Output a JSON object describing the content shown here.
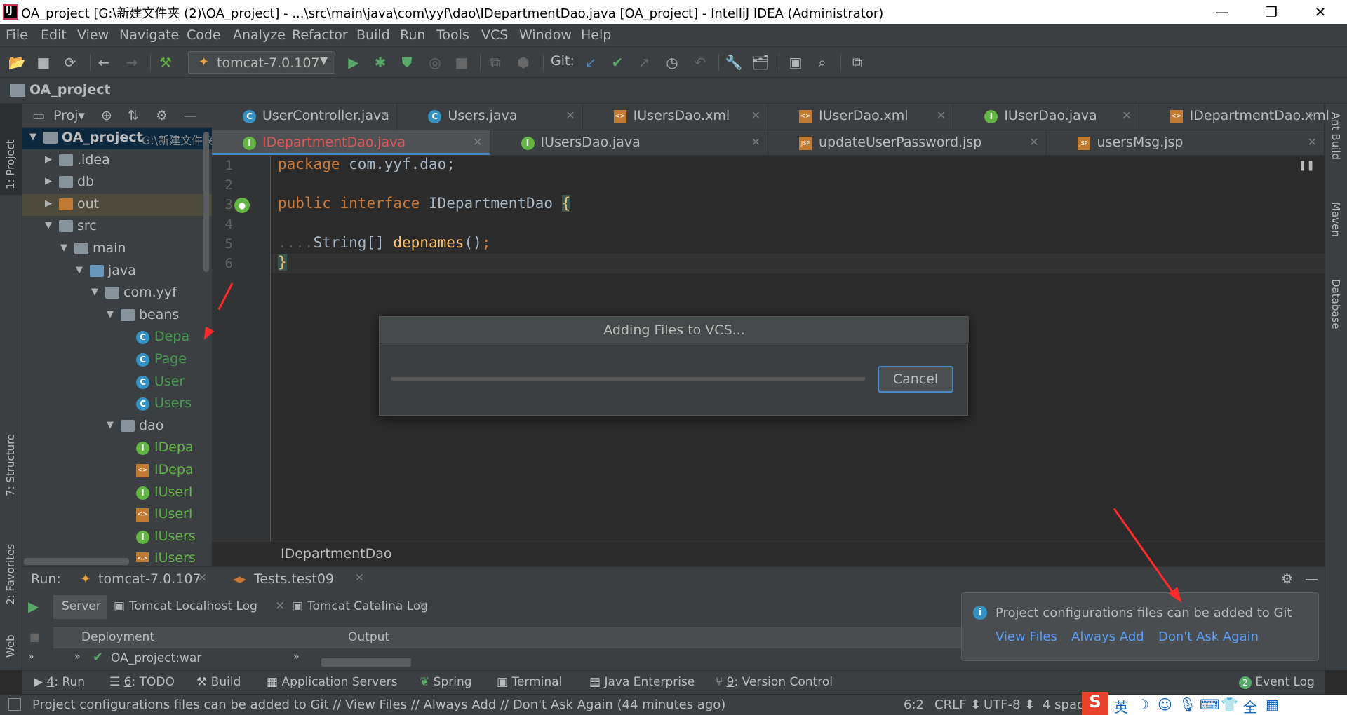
{
  "window": {
    "title": "OA_project [G:\\新建文件夹 (2)\\OA_project] - ...\\src\\main\\java\\com\\yyf\\dao\\IDepartmentDao.java [OA_project] - IntelliJ IDEA (Administrator)",
    "app_icon_letter": "IJ",
    "minimize": "—",
    "maximize": "❐",
    "close": "✕"
  },
  "menu": [
    "File",
    "Edit",
    "View",
    "Navigate",
    "Code",
    "Analyze",
    "Refactor",
    "Build",
    "Run",
    "Tools",
    "VCS",
    "Window",
    "Help"
  ],
  "toolbar": {
    "run_config": "tomcat-7.0.107",
    "git_label": "Git:"
  },
  "navbar": {
    "project": "OA_project"
  },
  "left_strip": {
    "project_tab": "1: Project",
    "structure_tab": "7: Structure",
    "favorites_tab": "2: Favorites",
    "web_tab": "Web"
  },
  "right_strip": {
    "ant_tab": "Ant Build",
    "maven_tab": "Maven",
    "database_tab": "Database"
  },
  "project_panel": {
    "header": "Proj▾",
    "tree": [
      {
        "label": "OA_project",
        "suffix": "G:\\新建文件夹",
        "icon": "project-folder",
        "level": 0,
        "expanded": true,
        "bold": true
      },
      {
        "label": ".idea",
        "icon": "folder",
        "level": 1,
        "expanded": false
      },
      {
        "label": "db",
        "icon": "folder",
        "level": 1,
        "expanded": false
      },
      {
        "label": "out",
        "icon": "folder-excluded",
        "level": 1,
        "expanded": false
      },
      {
        "label": "src",
        "icon": "folder",
        "level": 1,
        "expanded": true
      },
      {
        "label": "main",
        "icon": "folder",
        "level": 2,
        "expanded": true
      },
      {
        "label": "java",
        "icon": "source-folder",
        "level": 3,
        "expanded": true
      },
      {
        "label": "com.yyf",
        "icon": "package",
        "level": 4,
        "expanded": true
      },
      {
        "label": "beans",
        "icon": "package",
        "level": 5,
        "expanded": true
      },
      {
        "label": "Depa",
        "icon": "class",
        "level": 6
      },
      {
        "label": "Page",
        "icon": "class",
        "level": 6
      },
      {
        "label": "User",
        "icon": "class",
        "level": 6
      },
      {
        "label": "Users",
        "icon": "class",
        "level": 6
      },
      {
        "label": "dao",
        "icon": "package",
        "level": 5,
        "expanded": true
      },
      {
        "label": "IDepa",
        "icon": "interface",
        "level": 6
      },
      {
        "label": "IDepa",
        "icon": "xml",
        "level": 6
      },
      {
        "label": "IUserI",
        "icon": "interface",
        "level": 6
      },
      {
        "label": "IUserI",
        "icon": "xml",
        "level": 6
      },
      {
        "label": "IUsers",
        "icon": "interface",
        "level": 6
      },
      {
        "label": "IUsers",
        "icon": "xml",
        "level": 6
      }
    ]
  },
  "editor_tabs_row1": [
    {
      "label": "UserController.java",
      "icon": "class"
    },
    {
      "label": "Users.java",
      "icon": "class"
    },
    {
      "label": "IUsersDao.xml",
      "icon": "xml"
    },
    {
      "label": "IUserDao.xml",
      "icon": "xml"
    },
    {
      "label": "IUserDao.java",
      "icon": "interface"
    },
    {
      "label": "IDepartmentDao.xml",
      "icon": "xml"
    }
  ],
  "editor_tabs_row2": [
    {
      "label": "IDepartmentDao.java",
      "icon": "interface",
      "active": true
    },
    {
      "label": "IUsersDao.java",
      "icon": "interface"
    },
    {
      "label": "updateUserPassword.jsp",
      "icon": "jsp"
    },
    {
      "label": "usersMsg.jsp",
      "icon": "jsp"
    }
  ],
  "editor": {
    "line_numbers": [
      "1",
      "2",
      "3",
      "4",
      "5",
      "6"
    ],
    "code": {
      "l1_kw": "package",
      "l1_rest": " com.yyf.dao;",
      "l3_kw1": "public",
      "l3_kw2": "interface",
      "l3_name": " IDepartmentDao ",
      "l3_brace": "{",
      "l5_dots": "....",
      "l5_type": "String[] ",
      "l5_fn": "depnames",
      "l5_paren": "()",
      "l5_semi": ";",
      "l6_brace": "}"
    },
    "breadcrumb": "IDepartmentDao"
  },
  "dialog": {
    "title": "Adding Files to VCS...",
    "cancel": "Cancel"
  },
  "run_panel": {
    "label": "Run:",
    "tabs": [
      "tomcat-7.0.107",
      "Tests.test09"
    ],
    "subtabs": [
      "Server",
      "Tomcat Localhost Log",
      "Tomcat Catalina Log"
    ],
    "columns": [
      "Deployment",
      "Output"
    ],
    "row": "OA_project:war"
  },
  "notification": {
    "message": "Project configurations files can be added to Git",
    "actions": [
      "View Files",
      "Always Add",
      "Don't Ask Again"
    ]
  },
  "bottom_tools": [
    {
      "num": "4",
      "label": ": Run"
    },
    {
      "num": "6",
      "label": ": TODO"
    },
    {
      "num": "",
      "label": "Build"
    },
    {
      "num": "",
      "label": "Application Servers"
    },
    {
      "num": "",
      "label": "Spring"
    },
    {
      "num": "",
      "label": "Terminal"
    },
    {
      "num": "",
      "label": "Java Enterprise"
    },
    {
      "num": "9",
      "label": ": Version Control"
    }
  ],
  "event_log": {
    "count": "2",
    "label": "Event Log"
  },
  "status": {
    "message": "Project configurations files can be added to Git // View Files // Always Add // Don't Ask Again (44 minutes ago)",
    "position": "6:2",
    "line_sep": "CRLF ⬍",
    "encoding": "UTF-8 ⬍",
    "indent": "4 spac"
  },
  "tray": {
    "ime": "英"
  }
}
